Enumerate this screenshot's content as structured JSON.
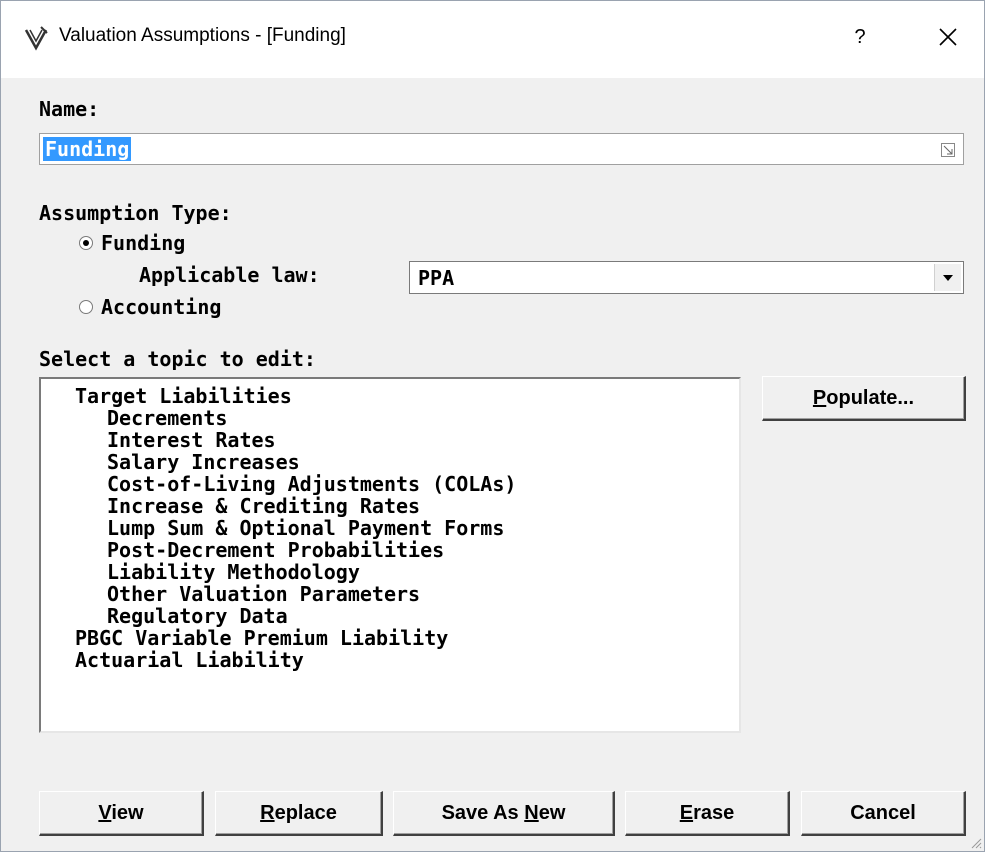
{
  "window": {
    "title": "Valuation Assumptions - [Funding]",
    "help_label": "?",
    "app_icon": "valuation-app-icon",
    "close_icon": "close-icon"
  },
  "name": {
    "label": "Name:",
    "value": "Funding"
  },
  "assumption_type": {
    "label": "Assumption Type:",
    "options": [
      {
        "label": "Funding",
        "selected": true
      },
      {
        "label": "Accounting",
        "selected": false
      }
    ],
    "applicable_law_label": "Applicable law:",
    "applicable_law_value": "PPA"
  },
  "topics": {
    "label": "Select a topic to edit:",
    "items": [
      {
        "label": "Target Liabilities",
        "level": 0
      },
      {
        "label": "Decrements",
        "level": 1
      },
      {
        "label": "Interest Rates",
        "level": 1
      },
      {
        "label": "Salary Increases",
        "level": 1
      },
      {
        "label": "Cost-of-Living Adjustments (COLAs)",
        "level": 1
      },
      {
        "label": "Increase & Crediting Rates",
        "level": 1
      },
      {
        "label": "Lump Sum & Optional Payment Forms",
        "level": 1
      },
      {
        "label": "Post-Decrement Probabilities",
        "level": 1
      },
      {
        "label": "Liability Methodology",
        "level": 1
      },
      {
        "label": "Other Valuation Parameters",
        "level": 1
      },
      {
        "label": "Regulatory Data",
        "level": 1
      },
      {
        "label": "PBGC Variable Premium Liability",
        "level": 0
      },
      {
        "label": "Actuarial Liability",
        "level": 0
      }
    ]
  },
  "buttons": {
    "populate": {
      "pre": "",
      "u": "P",
      "post": "opulate..."
    },
    "view": {
      "pre": "",
      "u": "V",
      "post": "iew"
    },
    "replace": {
      "pre": "",
      "u": "R",
      "post": "eplace"
    },
    "save_as_new": {
      "pre": "Save As ",
      "u": "N",
      "post": "ew"
    },
    "erase": {
      "pre": "",
      "u": "E",
      "post": "rase"
    },
    "cancel": {
      "pre": "Cancel",
      "u": "",
      "post": ""
    }
  }
}
